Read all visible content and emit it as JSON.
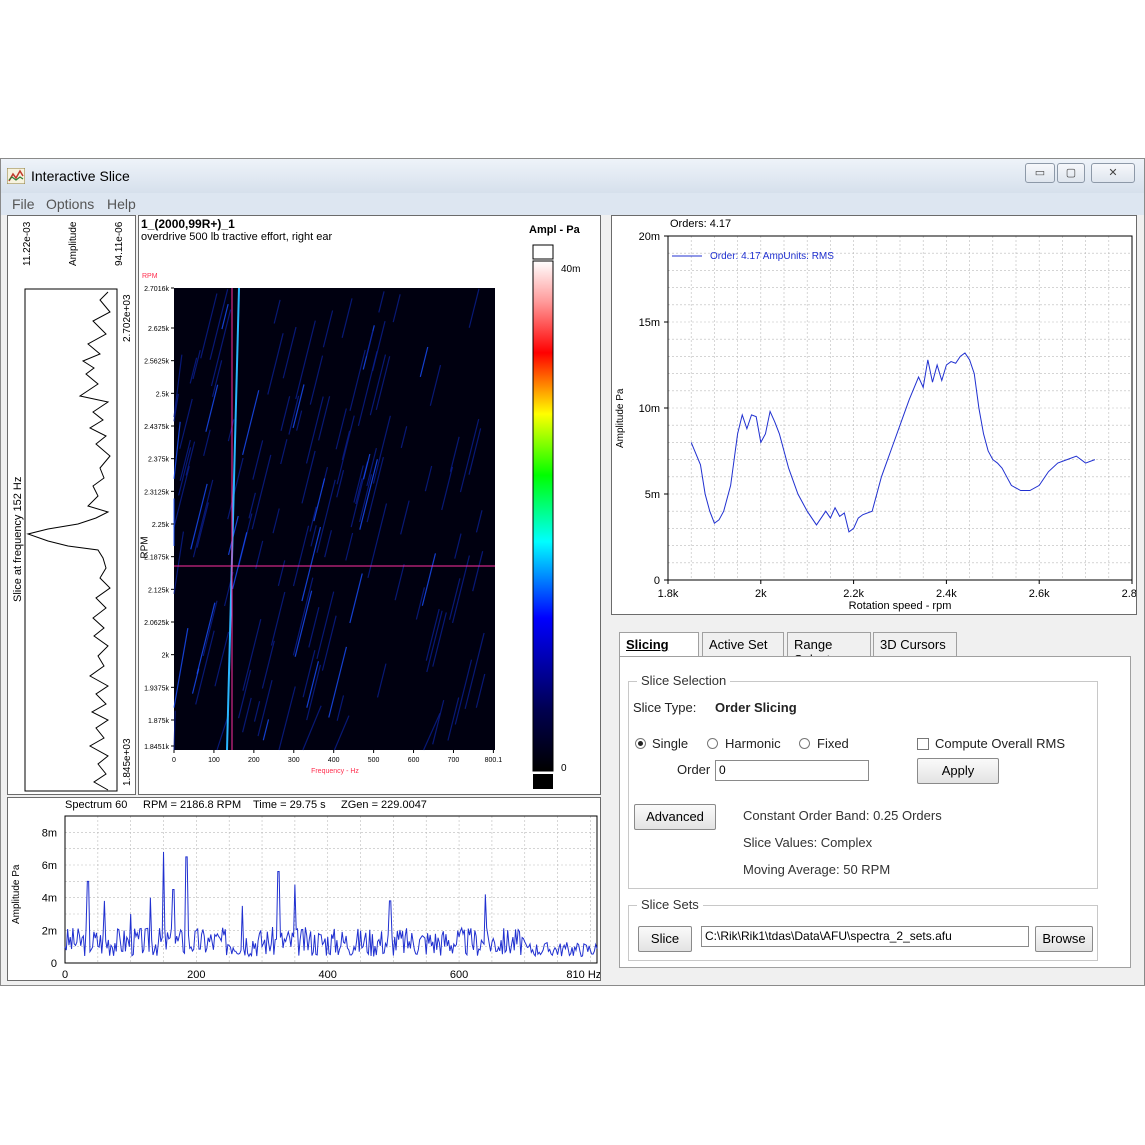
{
  "window": {
    "title": "Interactive Slice",
    "controls": {
      "minimize": "▭",
      "maximize": "▢",
      "close": "✕"
    },
    "icon": "chart-app-icon"
  },
  "menu": [
    "File",
    "Options",
    "Help"
  ],
  "rpm_slice": {
    "top_left": "11.22e-03",
    "top_mid": "Amplitude",
    "top_right": "94.11e-06",
    "side_label": "Slice at frequency 152 Hz",
    "right_top": "2.702e+03",
    "right_bottom": "1.845e+03"
  },
  "colormap": {
    "title": "1_(2000,99R+)_1",
    "subtitle": "overdrive 500 lb tractive effort, right ear",
    "colorbar_title": "Ampl - Pa",
    "colorbar_max": "40m",
    "colorbar_min": "0",
    "y_axis_label": "RPM",
    "y_unit_top": "RPM",
    "y_ticks": [
      "2.7016k",
      "2.625k",
      "2.5625k",
      "2.5k",
      "2.4375k",
      "2.375k",
      "2.3125k",
      "2.25k",
      "2.1875k",
      "2.125k",
      "2.0625k",
      "2k",
      "1.9375k",
      "1.875k",
      "1.8451k"
    ],
    "x_ticks": [
      "0",
      "100",
      "200",
      "300",
      "400",
      "500",
      "600",
      "700",
      "800.1"
    ],
    "x_axis_label": "Frequency - Hz",
    "cursor_rpm": 2187.5,
    "cursor_freq": 152
  },
  "order_plot": {
    "title": "Orders: 4.17",
    "legend": "Order: 4.17  AmpUnits: RMS",
    "ylabel": "Amplitude Pa",
    "xlabel": "Rotation speed - rpm",
    "y_ticks": [
      "0",
      "5m",
      "10m",
      "15m",
      "20m"
    ],
    "x_ticks": [
      "1.8k",
      "2k",
      "2.2k",
      "2.4k",
      "2.6k",
      "2.8k"
    ]
  },
  "spectrum": {
    "header": {
      "spectrum": "Spectrum 60",
      "rpm": "RPM = 2186.8 RPM",
      "time": "Time = 29.75 s",
      "zgen": "ZGen = 229.0047"
    },
    "ylabel": "Amplitude Pa",
    "y_ticks": [
      "0",
      "2m",
      "4m",
      "6m",
      "8m"
    ],
    "x_ticks": [
      "0",
      "200",
      "400",
      "600",
      "810 Hz"
    ]
  },
  "tabs": [
    "Slicing",
    "Active Set",
    "Range Select",
    "3D Cursors"
  ],
  "slice_selection": {
    "group_label": "Slice Selection",
    "slice_type_label": "Slice Type:",
    "slice_type_value": "Order Slicing",
    "radio_single": "Single",
    "radio_harmonic": "Harmonic",
    "radio_fixed": "Fixed",
    "checkbox_rms": "Compute Overall RMS",
    "order_label": "Order",
    "order_value": "0",
    "apply": "Apply",
    "advanced": "Advanced",
    "constant_band": "Constant Order Band: 0.25 Orders",
    "slice_values": "Slice Values: Complex",
    "moving_average": "Moving Average: 50 RPM"
  },
  "slice_sets": {
    "group_label": "Slice Sets",
    "slice_button": "Slice",
    "path": "C:\\Rik\\Rik1\\tdas\\Data\\AFU\\spectra_2_sets.afu",
    "browse": "Browse"
  },
  "chart_data": [
    {
      "type": "line",
      "title": "Orders: 4.17",
      "xlabel": "Rotation speed - rpm",
      "ylabel": "Amplitude Pa",
      "xlim": [
        1800,
        2800
      ],
      "ylim": [
        0,
        0.02
      ],
      "series": [
        {
          "name": "Order: 4.17  AmpUnits: RMS",
          "x": [
            1850,
            1870,
            1880,
            1890,
            1900,
            1910,
            1920,
            1935,
            1950,
            1960,
            1970,
            1980,
            1990,
            2000,
            2010,
            2020,
            2030,
            2040,
            2060,
            2080,
            2100,
            2120,
            2140,
            2150,
            2160,
            2170,
            2180,
            2190,
            2200,
            2210,
            2220,
            2240,
            2260,
            2280,
            2300,
            2320,
            2340,
            2350,
            2360,
            2370,
            2380,
            2390,
            2400,
            2410,
            2420,
            2430,
            2440,
            2450,
            2460,
            2470,
            2480,
            2490,
            2500,
            2510,
            2520,
            2530,
            2540,
            2560,
            2580,
            2600,
            2620,
            2640,
            2660,
            2680,
            2700,
            2720
          ],
          "values": [
            0.008,
            0.0067,
            0.005,
            0.004,
            0.0033,
            0.0035,
            0.004,
            0.0055,
            0.0085,
            0.0096,
            0.0088,
            0.0096,
            0.0095,
            0.008,
            0.0085,
            0.0098,
            0.0092,
            0.0085,
            0.0065,
            0.005,
            0.004,
            0.0032,
            0.004,
            0.0036,
            0.0042,
            0.0037,
            0.0039,
            0.0028,
            0.003,
            0.0036,
            0.0038,
            0.004,
            0.006,
            0.0075,
            0.009,
            0.0105,
            0.0118,
            0.0112,
            0.0128,
            0.0115,
            0.0125,
            0.0116,
            0.0125,
            0.0127,
            0.0126,
            0.013,
            0.0132,
            0.0128,
            0.012,
            0.01,
            0.0085,
            0.0075,
            0.007,
            0.0068,
            0.0065,
            0.006,
            0.0055,
            0.0052,
            0.0052,
            0.0055,
            0.0063,
            0.0068,
            0.007,
            0.0072,
            0.0068,
            0.007
          ]
        }
      ]
    },
    {
      "type": "line",
      "title": "Spectrum 60",
      "ylabel": "Amplitude Pa",
      "xlim": [
        0,
        810
      ],
      "ylim": [
        0,
        0.009
      ],
      "peaks": [
        {
          "x": 35,
          "y": 0.005
        },
        {
          "x": 60,
          "y": 0.0038
        },
        {
          "x": 100,
          "y": 0.003
        },
        {
          "x": 130,
          "y": 0.004
        },
        {
          "x": 150,
          "y": 0.0068
        },
        {
          "x": 165,
          "y": 0.0045
        },
        {
          "x": 185,
          "y": 0.0065
        },
        {
          "x": 270,
          "y": 0.0035
        },
        {
          "x": 325,
          "y": 0.0056
        },
        {
          "x": 350,
          "y": 0.0048
        },
        {
          "x": 495,
          "y": 0.0038
        },
        {
          "x": 640,
          "y": 0.0042
        }
      ]
    },
    {
      "type": "line",
      "title": "Slice at frequency 152 Hz",
      "ylabel": "RPM",
      "xlabel": "Amplitude",
      "ylim": [
        1845,
        2702
      ],
      "note": "vertical slice; main peak near 2240 RPM"
    }
  ]
}
